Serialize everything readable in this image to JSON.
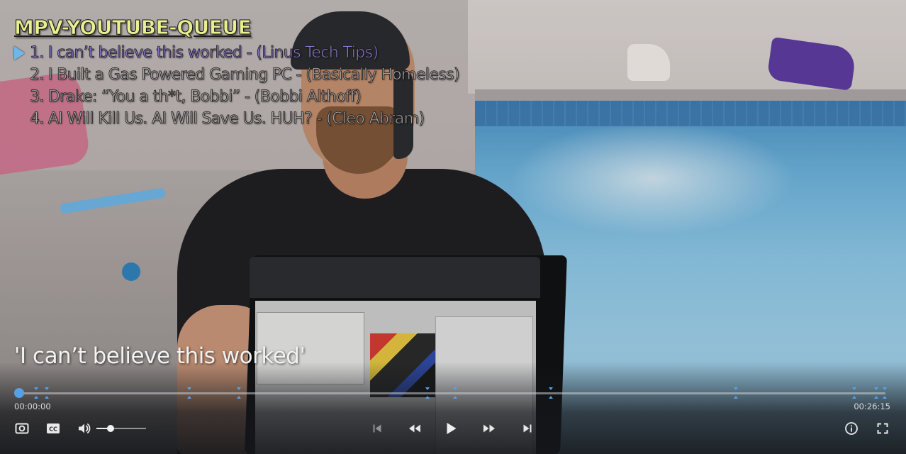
{
  "window": {
    "app": "mpv"
  },
  "playlist": {
    "title": "MPV-YOUTUBE-QUEUE",
    "items": [
      {
        "number": "1.",
        "text": "I can’t believe this worked - (Linus Tech Tips)",
        "active": true
      },
      {
        "number": "2.",
        "text": "I Built a Gas Powered Gaming PC - (Basically Homeless)",
        "active": false
      },
      {
        "number": "3.",
        "text": "Drake: “You a th*t, Bobbi” - (Bobbi Althoff)",
        "active": false
      },
      {
        "number": "4.",
        "text": "AI Will Kill Us. AI Will Save Us. HUH? - (Cleo Abram)",
        "active": false
      }
    ],
    "cursor_icon": "play-triangle-icon"
  },
  "caption": {
    "text": "'I can’t believe this worked'"
  },
  "seekbar": {
    "progress_fraction": 0.0,
    "chapter_fractions": [
      0.02,
      0.032,
      0.196,
      0.254,
      0.471,
      0.503,
      0.614,
      0.827,
      0.964,
      0.989,
      0.999
    ],
    "time_current": "00:00:00",
    "time_total": "00:26:15"
  },
  "controls": {
    "volume_fraction": 0.28,
    "left": [
      {
        "name": "screenshot-button",
        "icon": "camera-icon"
      },
      {
        "name": "subtitles-button",
        "icon": "cc-icon"
      },
      {
        "name": "volume-button",
        "icon": "speaker-icon"
      }
    ],
    "center": [
      {
        "name": "previous-button",
        "icon": "skip-previous-icon"
      },
      {
        "name": "rewind-button",
        "icon": "rewind-icon"
      },
      {
        "name": "play-button",
        "icon": "play-icon"
      },
      {
        "name": "fast-forward-button",
        "icon": "fast-forward-icon"
      },
      {
        "name": "next-button",
        "icon": "skip-next-icon"
      }
    ],
    "right": [
      {
        "name": "info-button",
        "icon": "info-icon"
      },
      {
        "name": "fullscreen-button",
        "icon": "fullscreen-icon"
      }
    ]
  },
  "colors": {
    "accent": "#56a0e8",
    "playlist_title": "#eaf08f",
    "active_item": "#8e79d4",
    "inactive_item": "#a9a4a2"
  }
}
